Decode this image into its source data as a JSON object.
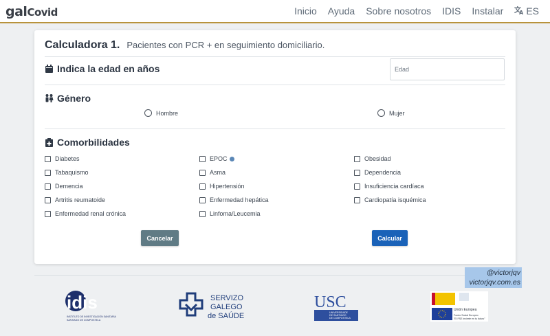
{
  "header": {
    "logo_gal": "gal",
    "logo_covid": "Covid",
    "nav": [
      "Inicio",
      "Ayuda",
      "Sobre nosotros",
      "IDIS",
      "Instalar"
    ],
    "lang_label": "ES",
    "lang_icon": "translate-icon"
  },
  "card": {
    "title": "Calculadora 1.",
    "subtitle": "Pacientes con PCR + en seguimiento domiciliario.",
    "age": {
      "label": "Indica la edad en años",
      "placeholder": "Edad",
      "value": "",
      "icon": "calendar-icon"
    },
    "gender": {
      "label": "Género",
      "icon": "people-icon",
      "options": [
        "Hombre",
        "Mujer"
      ]
    },
    "comorbidities": {
      "label": "Comorbilidades",
      "icon": "clipboard-icon",
      "col1": [
        "Diabetes",
        "Tabaquismo",
        "Demencia",
        "Artritis reumatoide",
        "Enfermedad renal crónica"
      ],
      "col2": [
        "EPOC",
        "Asma",
        "Hipertensión",
        "Enfermedad hepática",
        "Linfoma/Leucemia"
      ],
      "col3": [
        "Obesidad",
        "Dependencia",
        "Insuficiencia cardíaca",
        "Cardiopatía isquémica"
      ]
    },
    "buttons": {
      "cancel": "Cancelar",
      "calculate": "Calcular"
    }
  },
  "watermark": {
    "line1": "@victorjqv",
    "line2": "victorjqv.com.es"
  },
  "footer": {
    "idis": {
      "mark": "idis",
      "sub1": "INSTITUTO DE INVESTIGACIÓN SANITARIA",
      "sub2": "SANTIAGO DE COMPOSTELA"
    },
    "sergas": {
      "line1": "SERVIZO",
      "line2": "GALEGO",
      "line3": "de SAÚDE"
    },
    "usc": {
      "mark": "USC",
      "sub1": "UNIVERSIDADE",
      "sub2": "DE SANTIAGO",
      "sub3": "DE COMPOSTELA"
    },
    "eu": {
      "union": "Unión Europea",
      "fund1": "Fondo Social Europeo",
      "fund2": "\"El FSE invierte en tu futuro\""
    }
  },
  "colors": {
    "accent": "#b8933c",
    "primary_button": "#1a62b8",
    "secondary_button": "#607b85"
  }
}
